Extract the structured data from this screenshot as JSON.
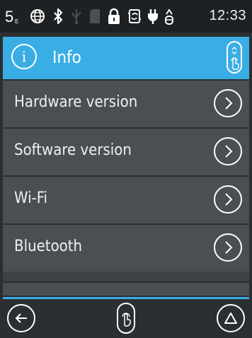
{
  "statusbar": {
    "time": "12:33",
    "icons": [
      "wifi-level-5-icon",
      "globe-icon",
      "bluetooth-icon",
      "usb-icon",
      "sd-card-icon",
      "lock-icon",
      "sync-icon",
      "power-plug-icon",
      "battery-icon"
    ]
  },
  "header": {
    "icon_letter": "i",
    "title": "Info",
    "accent_color": "#3aaee4"
  },
  "menu": {
    "items": [
      {
        "label": "Hardware version"
      },
      {
        "label": "Software version"
      },
      {
        "label": "Wi-Fi"
      },
      {
        "label": "Bluetooth"
      }
    ]
  },
  "bottom_nav": {
    "icons": [
      "back-icon",
      "touch-icon",
      "home-icon"
    ]
  },
  "colors": {
    "accent": "#3aaee4",
    "row_bg": "#4a4f53",
    "background": "#2c2f31"
  }
}
